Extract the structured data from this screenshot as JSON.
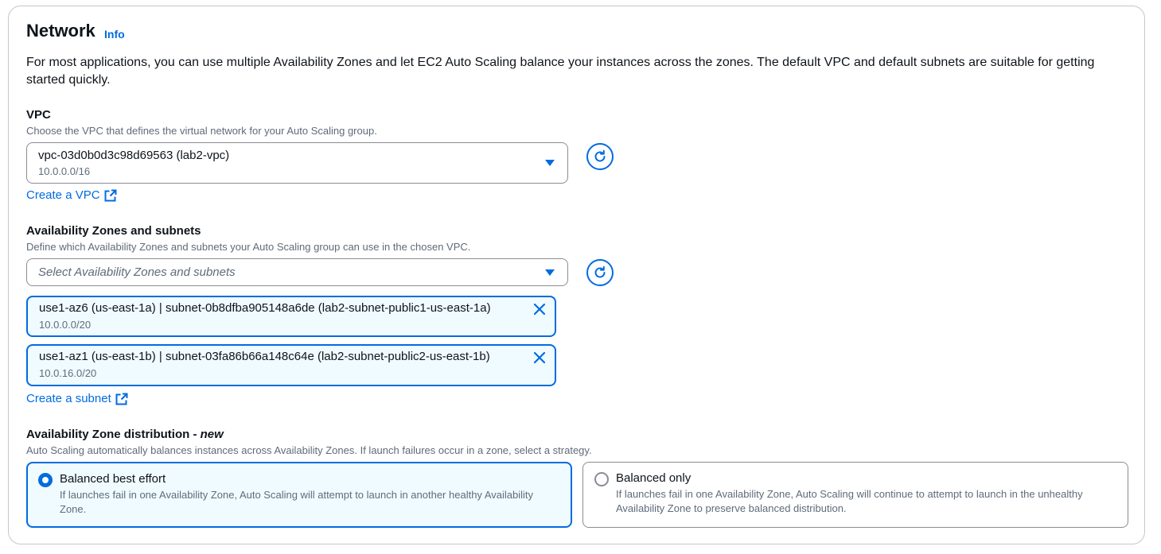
{
  "section": {
    "title": "Network",
    "info_link": "Info",
    "description": "For most applications, you can use multiple Availability Zones and let EC2 Auto Scaling balance your instances across the zones. The default VPC and default subnets are suitable for getting started quickly."
  },
  "vpc": {
    "label": "VPC",
    "hint": "Choose the VPC that defines the virtual network for your Auto Scaling group.",
    "selected_value": "vpc-03d0b0d3c98d69563 (lab2-vpc)",
    "selected_cidr": "10.0.0.0/16",
    "create_link": "Create a VPC"
  },
  "subnets": {
    "label": "Availability Zones and subnets",
    "hint": "Define which Availability Zones and subnets your Auto Scaling group can use in the chosen VPC.",
    "placeholder": "Select Availability Zones and subnets",
    "selected": [
      {
        "label": "use1-az6 (us-east-1a) | subnet-0b8dfba905148a6de (lab2-subnet-public1-us-east-1a)",
        "cidr": "10.0.0.0/20"
      },
      {
        "label": "use1-az1 (us-east-1b) | subnet-03fa86b66a148c64e (lab2-subnet-public2-us-east-1b)",
        "cidr": "10.0.16.0/20"
      }
    ],
    "create_link": "Create a subnet"
  },
  "distribution": {
    "label": "Availability Zone distribution - ",
    "label_new": "new",
    "hint": "Auto Scaling automatically balances instances across Availability Zones. If launch failures occur in a zone, select a strategy.",
    "options": [
      {
        "title": "Balanced best effort",
        "description": "If launches fail in one Availability Zone, Auto Scaling will attempt to launch in another healthy Availability Zone.",
        "selected": true
      },
      {
        "title": "Balanced only",
        "description": "If launches fail in one Availability Zone, Auto Scaling will continue to attempt to launch in the unhealthy Availability Zone to preserve balanced distribution.",
        "selected": false
      }
    ]
  },
  "colors": {
    "accent": "#006ce0",
    "selected_bg": "#f0fbff",
    "border": "#8c8c94",
    "hint_text": "#5f6b7a"
  },
  "icons": [
    "refresh-icon",
    "external-link-icon",
    "close-icon",
    "caret-down-icon"
  ]
}
